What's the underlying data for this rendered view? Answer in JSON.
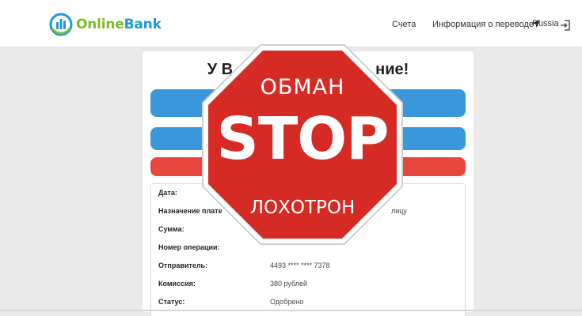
{
  "header": {
    "logo": {
      "online": "Online",
      "bank": "Bank"
    },
    "nav": {
      "accounts": "Счета",
      "transfer_info": "Информация о переводе",
      "language": "Russia"
    }
  },
  "panel": {
    "headline_left": "У В",
    "headline_right": "ние!",
    "rows": [
      {
        "label": "Дата:",
        "value": ""
      },
      {
        "label": "Назначение плате",
        "value": "лицу"
      },
      {
        "label": "Сумма:",
        "value": ""
      },
      {
        "label": "Номер операции:",
        "value": ""
      },
      {
        "label": "Отправитель:",
        "value": "4493 **** **** 7378"
      },
      {
        "label": "Комиссия:",
        "value": "380 рублей"
      },
      {
        "label": "Статус:",
        "value": "Одобрено"
      }
    ]
  },
  "stop_sign": {
    "top": "ОБМАН",
    "main": "STOP",
    "bottom": "ЛОХОТРОН"
  },
  "colors": {
    "blue_bar": "#3a97dc",
    "red_bar": "#e8473f",
    "stop_red": "#d62a24",
    "logo_green": "#7dbb2c",
    "logo_blue": "#1f9ad6"
  }
}
